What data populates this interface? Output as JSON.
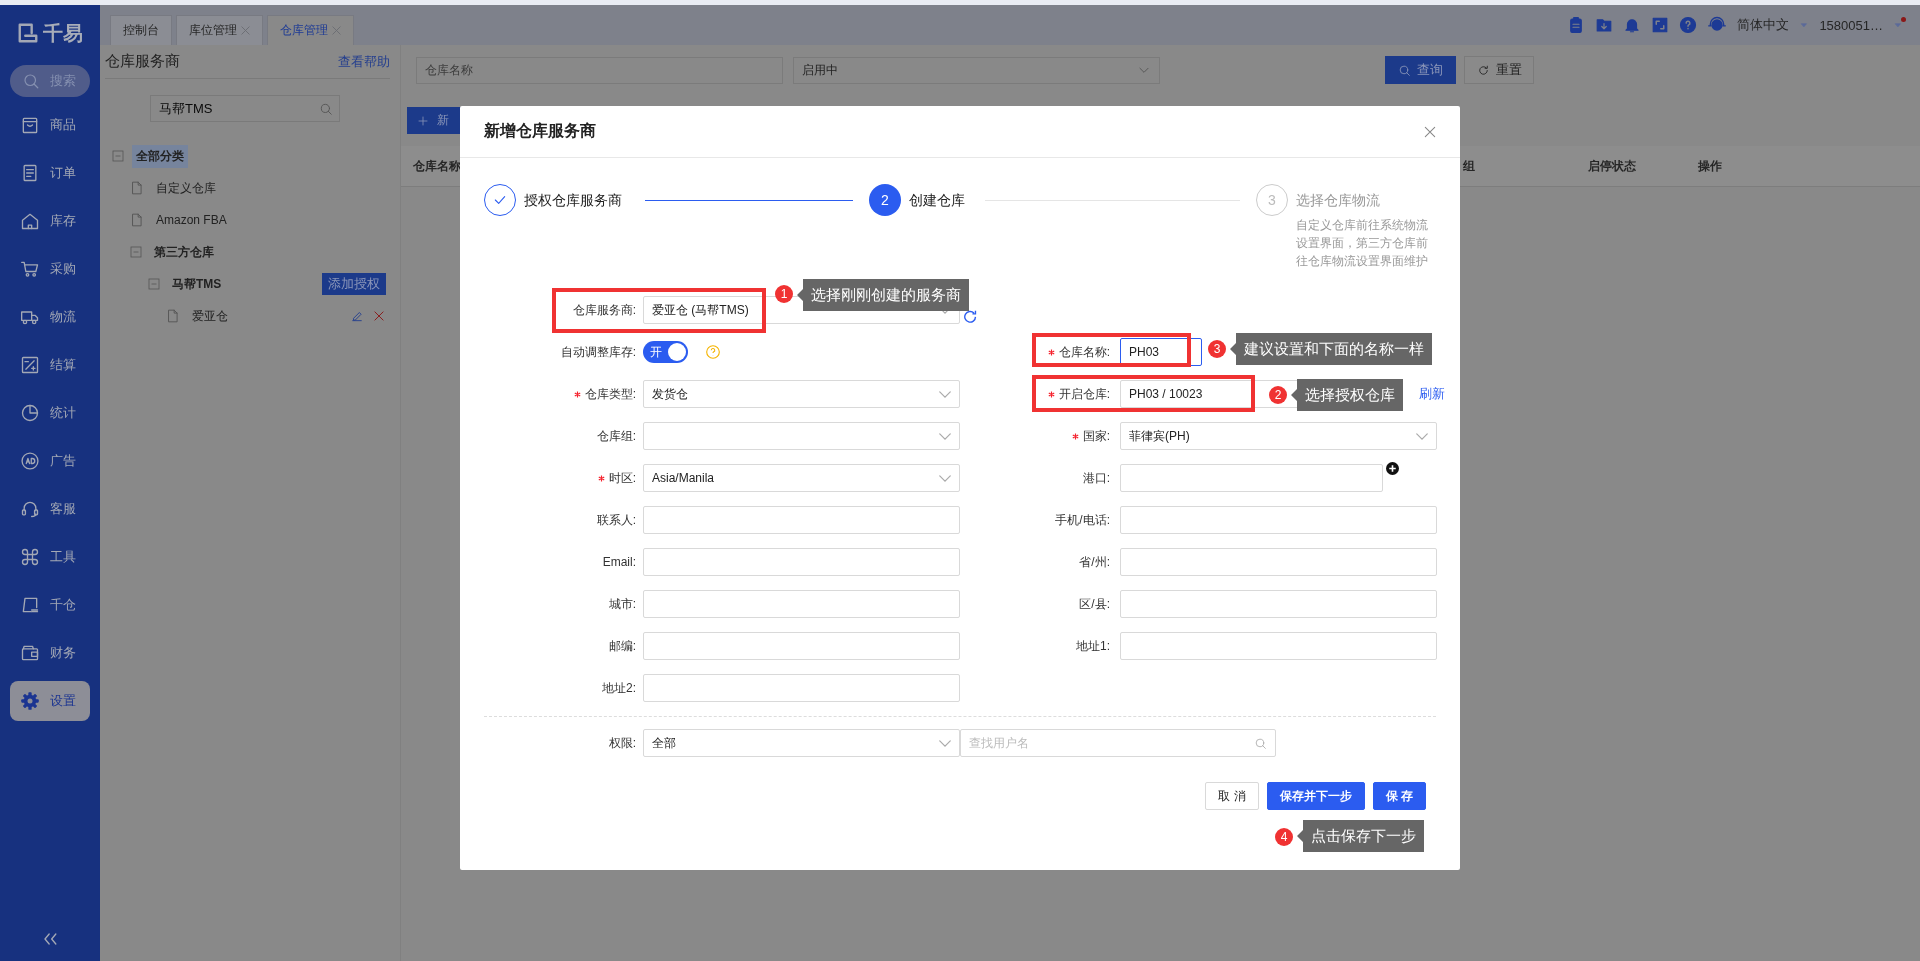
{
  "sidebar": {
    "logo": "千易",
    "search": "搜索",
    "items": [
      {
        "label": "商品",
        "selected": false
      },
      {
        "label": "订单",
        "selected": false
      },
      {
        "label": "库存",
        "selected": false
      },
      {
        "label": "采购",
        "selected": false
      },
      {
        "label": "物流",
        "selected": false
      },
      {
        "label": "结算",
        "selected": false
      },
      {
        "label": "统计",
        "selected": false
      },
      {
        "label": "广告",
        "selected": false
      },
      {
        "label": "客服",
        "selected": false
      },
      {
        "label": "工具",
        "selected": false
      },
      {
        "label": "千仓",
        "selected": false
      },
      {
        "label": "财务",
        "selected": false
      },
      {
        "label": "设置",
        "selected": true
      }
    ]
  },
  "tabs": [
    {
      "label": "控制台",
      "closable": false,
      "selected": false
    },
    {
      "label": "库位管理",
      "closable": true,
      "selected": false
    },
    {
      "label": "仓库管理",
      "closable": true,
      "selected": true
    }
  ],
  "header": {
    "language": "简体中文",
    "user": "1580051…"
  },
  "left_panel": {
    "title": "仓库服务商",
    "help_link": "查看帮助",
    "search": {
      "value": "马帮TMS"
    },
    "tree": [
      {
        "label": "全部分类",
        "selected": true,
        "expanded": true,
        "children": [
          {
            "label": "自定义仓库",
            "selected": false,
            "editable": false
          },
          {
            "label": "Amazon FBA",
            "selected": false,
            "editable": false
          },
          {
            "label": "第三方仓库",
            "selected": false,
            "expanded": true,
            "children": [
              {
                "label": "马帮TMS",
                "selected": false,
                "expanded": true,
                "action": "添加授权",
                "children": [
                  {
                    "label": "爱亚仓",
                    "selected": false,
                    "editable": true
                  }
                ]
              }
            ]
          }
        ]
      }
    ]
  },
  "filters": {
    "name_placeholder": "仓库名称",
    "status_value": "启用中",
    "search_button": "查询",
    "reset_button": "重置"
  },
  "add_button": "新",
  "table": {
    "columns": [
      "仓库名称",
      "组",
      "启停状态",
      "操作"
    ]
  },
  "modal": {
    "title": "新增仓库服务商",
    "steps": [
      {
        "label": "授权仓库服务商",
        "kind": "done"
      },
      {
        "label": "创建仓库",
        "kind": "active",
        "number": "2"
      },
      {
        "label": "选择仓库物流",
        "kind": "waiting",
        "number": "3",
        "description": "自定义仓库前往系统物流设置界面，第三方仓库前往仓库物流设置界面维护"
      }
    ],
    "rows": [
      {
        "left": {
          "kind": "select",
          "label": "仓库服务商:",
          "required": false,
          "value": "爱亚仓 (马帮TMS)",
          "refresh": true
        }
      },
      {
        "left": {
          "kind": "toggle",
          "label": "自动调整库存:",
          "required": false,
          "on": true,
          "text": "开",
          "help": true
        },
        "right": {
          "kind": "input",
          "label": "仓库名称:",
          "required": true,
          "value": "PH03",
          "focused": true
        }
      },
      {
        "left": {
          "kind": "select",
          "label": "仓库类型:",
          "required": true,
          "value": "发货仓"
        },
        "right": {
          "kind": "select",
          "label": "开启仓库:",
          "required": true,
          "value": "PH03 / 10023",
          "link": "刷新"
        }
      },
      {
        "left": {
          "kind": "select",
          "label": "仓库组:",
          "required": false
        },
        "right": {
          "kind": "select",
          "label": "国家:",
          "required": true,
          "value": "菲律宾(PH)"
        }
      },
      {
        "left": {
          "kind": "select",
          "label": "时区:",
          "required": true,
          "value": "Asia/Manila"
        },
        "right": {
          "kind": "input",
          "label": "港口:",
          "required": false,
          "focused": false,
          "add": true
        }
      },
      {
        "left": {
          "kind": "input",
          "label": "联系人:",
          "required": false,
          "focused": false
        },
        "right": {
          "kind": "input",
          "label": "手机/电话:",
          "required": false,
          "focused": false
        }
      },
      {
        "left": {
          "kind": "input",
          "label": "Email:",
          "required": false,
          "focused": false
        },
        "right": {
          "kind": "input",
          "label": "省/州:",
          "required": false,
          "focused": false
        }
      },
      {
        "left": {
          "kind": "input",
          "label": "城市:",
          "required": false,
          "focused": false
        },
        "right": {
          "kind": "input",
          "label": "区/县:",
          "required": false,
          "focused": false
        }
      },
      {
        "left": {
          "kind": "input",
          "label": "邮编:",
          "required": false,
          "focused": false
        },
        "right": {
          "kind": "input",
          "label": "地址1:",
          "required": false,
          "focused": false
        }
      },
      {
        "left": {
          "kind": "input",
          "label": "地址2:",
          "required": false,
          "focused": false
        }
      }
    ],
    "permission": {
      "label": "权限:",
      "value": "全部",
      "search_placeholder": "查找用户名"
    },
    "buttons": [
      {
        "label": "取 消",
        "kind": "default"
      },
      {
        "label": "保存并下一步",
        "kind": "primary"
      },
      {
        "label": "保 存",
        "kind": "primary"
      }
    ],
    "annotations": [
      {
        "number": "1",
        "text": "选择刚刚创建的服务商"
      },
      {
        "number": "3",
        "text": "建议设置和下面的名称一样"
      },
      {
        "number": "2",
        "text": "选择授权仓库"
      },
      {
        "number": "4",
        "text": "点击保存下一步"
      }
    ]
  }
}
